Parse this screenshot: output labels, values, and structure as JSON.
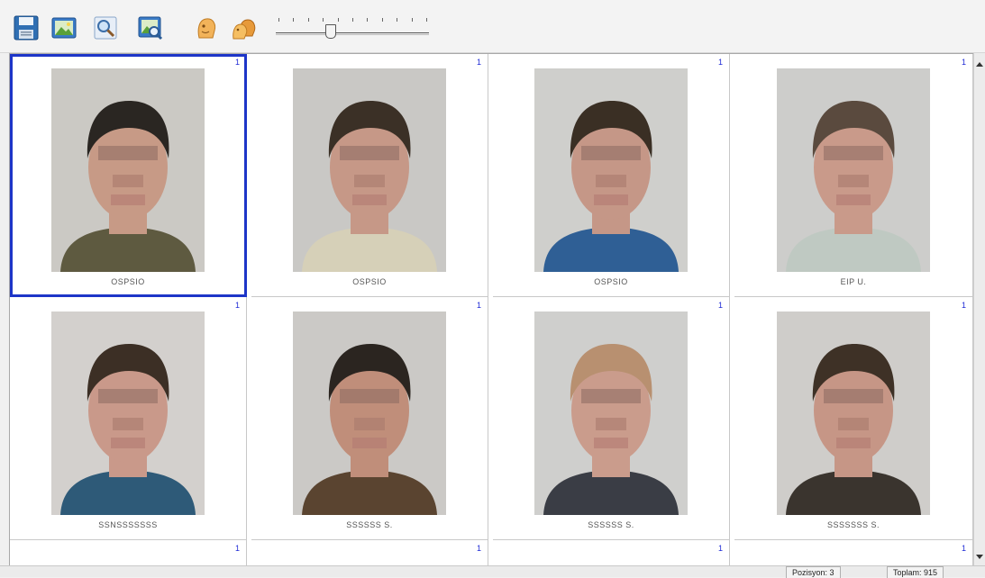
{
  "toolbar": {
    "buttons": [
      {
        "name": "save-button",
        "icon": "floppy-disk-icon"
      },
      {
        "name": "image-button",
        "icon": "picture-icon"
      },
      {
        "name": "zoom-button",
        "icon": "magnifier-icon"
      },
      {
        "name": "image-search-button",
        "icon": "image-zoom-icon"
      },
      {
        "name": "face-button",
        "icon": "head-icon"
      },
      {
        "name": "faces-button",
        "icon": "heads-icon"
      }
    ],
    "zoom_slider": {
      "ticks": 11,
      "value_fraction": 0.35
    }
  },
  "grid": {
    "selected_index": 0,
    "cells": [
      {
        "index": "1",
        "caption": "OSPSIO",
        "hair": "#2a2622",
        "shirt": "#5e5a40",
        "skin": "#c79a86",
        "bg": "#cbc9c4"
      },
      {
        "index": "1",
        "caption": "OSPSIO",
        "hair": "#3b3026",
        "shirt": "#d6d0b8",
        "skin": "#c69887",
        "bg": "#c9c8c5"
      },
      {
        "index": "1",
        "caption": "OSPSIO",
        "hair": "#3a2f24",
        "shirt": "#2f5f95",
        "skin": "#c59787",
        "bg": "#cfcfcc"
      },
      {
        "index": "1",
        "caption": "EIP U.",
        "hair": "#5a4a3e",
        "shirt": "#bfc9c2",
        "skin": "#c99a8a",
        "bg": "#cdcdcb"
      },
      {
        "index": "1",
        "caption": "SSNSSSSSSS",
        "hair": "#3c2f25",
        "shirt": "#2e5a78",
        "skin": "#c9998a",
        "bg": "#d3d0cd"
      },
      {
        "index": "1",
        "caption": "SSSSSS S.",
        "hair": "#2b2520",
        "shirt": "#5a4430",
        "skin": "#c08e7a",
        "bg": "#cbc9c6"
      },
      {
        "index": "1",
        "caption": "SSSSSS S.",
        "hair": "#b89070",
        "shirt": "#3a3d45",
        "skin": "#ca9c8c",
        "bg": "#cfcfcd"
      },
      {
        "index": "1",
        "caption": "SSSSSSS S.",
        "hair": "#3e3126",
        "shirt": "#3a342e",
        "skin": "#c69686",
        "bg": "#cfcdca"
      },
      {
        "index": "1",
        "caption": ""
      },
      {
        "index": "1",
        "caption": ""
      },
      {
        "index": "1",
        "caption": ""
      },
      {
        "index": "1",
        "caption": ""
      }
    ]
  },
  "status": {
    "position": "Pozisyon: 3",
    "total": "Toplam: 915"
  }
}
